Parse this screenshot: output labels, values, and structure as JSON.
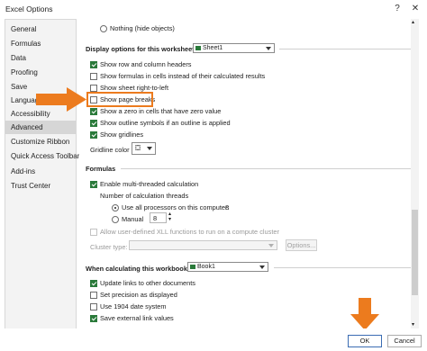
{
  "window": {
    "title": "Excel Options",
    "help_glyph": "?",
    "close_glyph": "✕"
  },
  "sidebar": {
    "items": [
      {
        "label": "General"
      },
      {
        "label": "Formulas"
      },
      {
        "label": "Data"
      },
      {
        "label": "Proofing"
      },
      {
        "label": "Save"
      },
      {
        "label": "Language"
      },
      {
        "label": "Accessibility"
      },
      {
        "label": "Advanced"
      },
      {
        "label": "Customize Ribbon"
      },
      {
        "label": "Quick Access Toolbar"
      },
      {
        "label": "Add-ins"
      },
      {
        "label": "Trust Center"
      }
    ],
    "selected": "Advanced"
  },
  "worksheet_section": {
    "nothing_radio_label": "Nothing (hide objects)",
    "heading": "Display options for this worksheet:",
    "sheet_value": "Sheet1",
    "options": [
      {
        "label": "Show row and column headers",
        "checked": true
      },
      {
        "label": "Show formulas in cells instead of their calculated results",
        "checked": false
      },
      {
        "label": "Show sheet right-to-left",
        "checked": false
      },
      {
        "label": "Show page breaks",
        "checked": false
      },
      {
        "label": "Show a zero in cells that have zero value",
        "checked": true
      },
      {
        "label": "Show outline symbols if an outline is applied",
        "checked": true
      },
      {
        "label": "Show gridlines",
        "checked": true
      }
    ],
    "gridline_color_label": "Gridline color"
  },
  "formulas_section": {
    "heading": "Formulas",
    "multithread_label": "Enable multi-threaded calculation",
    "threads_heading": "Number of calculation threads",
    "use_all_label": "Use all processors on this computer:",
    "processor_count": "8",
    "manual_label": "Manual",
    "manual_value": "8",
    "xll_label": "Allow user-defined XLL functions to run on a compute cluster",
    "cluster_type_label": "Cluster type:",
    "options_button": "Options..."
  },
  "workbook_section": {
    "heading": "When calculating this workbook:",
    "workbook_value": "Book1",
    "options": [
      {
        "label": "Update links to other documents",
        "checked": true
      },
      {
        "label": "Set precision as displayed",
        "checked": false
      },
      {
        "label": "Use 1904 date system",
        "checked": false
      },
      {
        "label": "Save external link values",
        "checked": true
      }
    ]
  },
  "footer": {
    "ok_label": "OK",
    "cancel_label": "Cancel"
  },
  "colors": {
    "accent_orange": "#ec7b1e",
    "check_green": "#2a7a3a",
    "selected_nav": "#d6d6d6"
  }
}
